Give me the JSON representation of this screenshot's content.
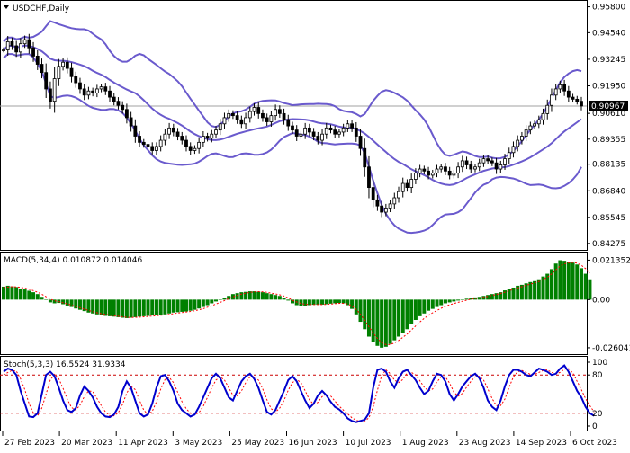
{
  "symbol_label": "USDCHF,Daily",
  "current_price_label": "0.90967",
  "price_axis_labels": [
    "0.95800",
    "0.94540",
    "0.93245",
    "0.91950",
    "0.90610",
    "0.89355",
    "0.88135",
    "0.86840",
    "0.85545",
    "0.84275"
  ],
  "macd": {
    "title": "MACD(5,34,4) 0.010872 0.014046",
    "axis_labels": [
      "0.021352",
      "0.00",
      "-0.026041"
    ]
  },
  "stoch": {
    "title": "Stoch(5,3,3) 16.5524 31.9334",
    "axis_labels": [
      "100",
      "80",
      "20",
      "0"
    ]
  },
  "date_labels": [
    "27 Feb 2023",
    "20 Mar 2023",
    "11 Apr 2023",
    "3 May 2023",
    "25 May 2023",
    "16 Jun 2023",
    "10 Jul 2023",
    "1 Aug 2023",
    "23 Aug 2023",
    "14 Sep 2023",
    "6 Oct 2023"
  ],
  "colors": {
    "candle": "#000000",
    "bollinger": "#6a5acd",
    "macd_hist": "#008000",
    "macd_signal": "#ff0000",
    "stoch_main": "#0000cd",
    "stoch_signal": "#ff0000",
    "level_line": "#cc0000",
    "grid_price": "#a0a0a0"
  },
  "chart_data": [
    {
      "type": "candlestick",
      "title": "USDCHF,Daily",
      "ylim": [
        0.8405,
        0.96
      ],
      "closes": [
        0.937,
        0.941,
        0.939,
        0.936,
        0.94,
        0.942,
        0.938,
        0.934,
        0.93,
        0.926,
        0.918,
        0.912,
        0.923,
        0.929,
        0.931,
        0.928,
        0.924,
        0.921,
        0.918,
        0.915,
        0.917,
        0.916,
        0.918,
        0.919,
        0.917,
        0.914,
        0.912,
        0.91,
        0.908,
        0.904,
        0.9,
        0.895,
        0.892,
        0.891,
        0.89,
        0.888,
        0.89,
        0.893,
        0.896,
        0.899,
        0.897,
        0.895,
        0.893,
        0.89,
        0.888,
        0.889,
        0.892,
        0.895,
        0.894,
        0.896,
        0.898,
        0.901,
        0.904,
        0.906,
        0.905,
        0.903,
        0.901,
        0.904,
        0.907,
        0.909,
        0.906,
        0.904,
        0.902,
        0.905,
        0.908,
        0.906,
        0.903,
        0.9,
        0.898,
        0.895,
        0.896,
        0.899,
        0.897,
        0.895,
        0.893,
        0.896,
        0.899,
        0.898,
        0.896,
        0.897,
        0.899,
        0.901,
        0.899,
        0.895,
        0.889,
        0.88,
        0.87,
        0.864,
        0.861,
        0.858,
        0.86,
        0.862,
        0.865,
        0.868,
        0.872,
        0.87,
        0.874,
        0.877,
        0.879,
        0.878,
        0.876,
        0.877,
        0.879,
        0.88,
        0.878,
        0.876,
        0.877,
        0.88,
        0.883,
        0.881,
        0.879,
        0.88,
        0.882,
        0.884,
        0.883,
        0.882,
        0.879,
        0.881,
        0.884,
        0.887,
        0.89,
        0.893,
        0.895,
        0.898,
        0.9,
        0.901,
        0.903,
        0.906,
        0.91,
        0.915,
        0.918,
        0.92,
        0.917,
        0.914,
        0.913,
        0.912,
        0.9097
      ]
    },
    {
      "type": "bar",
      "title": "MACD(5,34,4) 0.010872 0.014046",
      "ylim": [
        -0.0285,
        0.0235
      ],
      "values": [
        0.007,
        0.0075,
        0.0072,
        0.0068,
        0.006,
        0.0055,
        0.0048,
        0.004,
        0.003,
        0.0015,
        0.0,
        -0.0015,
        -0.002,
        -0.0018,
        -0.0025,
        -0.0032,
        -0.004,
        -0.0048,
        -0.0055,
        -0.0062,
        -0.007,
        -0.0075,
        -0.008,
        -0.0085,
        -0.0088,
        -0.009,
        -0.0092,
        -0.0095,
        -0.0098,
        -0.01,
        -0.0098,
        -0.0095,
        -0.0092,
        -0.009,
        -0.0088,
        -0.0086,
        -0.0085,
        -0.0083,
        -0.008,
        -0.0075,
        -0.007,
        -0.0068,
        -0.0066,
        -0.0064,
        -0.006,
        -0.0055,
        -0.0048,
        -0.004,
        -0.003,
        -0.002,
        -0.001,
        0.0,
        0.001,
        0.002,
        0.003,
        0.0035,
        0.004,
        0.0042,
        0.0045,
        0.0045,
        0.0043,
        0.004,
        0.0035,
        0.003,
        0.0025,
        0.002,
        0.001,
        -0.0005,
        -0.002,
        -0.003,
        -0.0035,
        -0.0033,
        -0.003,
        -0.0028,
        -0.0028,
        -0.0027,
        -0.0025,
        -0.0022,
        -0.002,
        -0.0018,
        -0.002,
        -0.003,
        -0.005,
        -0.008,
        -0.012,
        -0.016,
        -0.02,
        -0.023,
        -0.025,
        -0.026,
        -0.0255,
        -0.024,
        -0.022,
        -0.02,
        -0.018,
        -0.016,
        -0.013,
        -0.011,
        -0.009,
        -0.0075,
        -0.006,
        -0.005,
        -0.004,
        -0.003,
        -0.002,
        -0.0015,
        -0.001,
        -0.0005,
        0.0,
        0.0005,
        0.001,
        0.0012,
        0.0015,
        0.002,
        0.0025,
        0.003,
        0.0035,
        0.004,
        0.005,
        0.006,
        0.0065,
        0.0075,
        0.008,
        0.0088,
        0.0095,
        0.01,
        0.011,
        0.0125,
        0.014,
        0.0165,
        0.0195,
        0.0213,
        0.021,
        0.0205,
        0.02,
        0.019,
        0.017,
        0.014,
        0.011
      ],
      "signal": [
        0.0065,
        0.0068,
        0.007,
        0.0069,
        0.0066,
        0.0062,
        0.0056,
        0.0049,
        0.004,
        0.0029,
        0.0016,
        0.0003,
        -0.0006,
        -0.0011,
        -0.0017,
        -0.0023,
        -0.003,
        -0.0037,
        -0.0044,
        -0.0051,
        -0.0058,
        -0.0065,
        -0.0071,
        -0.0076,
        -0.008,
        -0.0084,
        -0.0087,
        -0.009,
        -0.0093,
        -0.0096,
        -0.0097,
        -0.0096,
        -0.0095,
        -0.0093,
        -0.0091,
        -0.0089,
        -0.0087,
        -0.0085,
        -0.0083,
        -0.008,
        -0.0076,
        -0.0073,
        -0.007,
        -0.0067,
        -0.0064,
        -0.006,
        -0.0055,
        -0.0049,
        -0.0041,
        -0.0033,
        -0.0024,
        -0.0015,
        -0.0005,
        0.0005,
        0.0015,
        0.0023,
        0.003,
        0.0035,
        0.0039,
        0.0042,
        0.0043,
        0.0042,
        0.0039,
        0.0035,
        0.0031,
        0.0026,
        0.0019,
        0.0009,
        -0.0003,
        -0.0013,
        -0.0021,
        -0.0025,
        -0.0027,
        -0.0027,
        -0.0027,
        -0.0027,
        -0.0026,
        -0.0024,
        -0.0022,
        -0.002,
        -0.002,
        -0.0024,
        -0.0034,
        -0.0052,
        -0.0079,
        -0.0111,
        -0.0147,
        -0.018,
        -0.021,
        -0.0232,
        -0.0243,
        -0.0243,
        -0.0234,
        -0.0221,
        -0.0204,
        -0.0186,
        -0.0164,
        -0.0142,
        -0.0121,
        -0.0102,
        -0.0085,
        -0.0071,
        -0.0059,
        -0.0047,
        -0.0036,
        -0.0028,
        -0.0021,
        -0.0015,
        -0.0009,
        -0.0003,
        0.0002,
        0.0006,
        0.0009,
        0.0013,
        0.0018,
        0.0023,
        0.0028,
        0.0033,
        0.004,
        0.0048,
        0.0055,
        0.0063,
        0.007,
        0.0077,
        0.0084,
        0.009,
        0.0098,
        0.0109,
        0.0121,
        0.0139,
        0.0161,
        0.0182,
        0.0193,
        0.02,
        0.0201,
        0.0197,
        0.0186,
        0.0168,
        0.0144
      ]
    },
    {
      "type": "line",
      "title": "Stoch(5,3,3) 16.5524 31.9334",
      "ylim": [
        0,
        100
      ],
      "levels": [
        80,
        20
      ],
      "series": [
        {
          "values": [
            85,
            90,
            88,
            80,
            55,
            35,
            15,
            14,
            20,
            50,
            80,
            85,
            78,
            60,
            40,
            25,
            22,
            28,
            48,
            62,
            55,
            45,
            30,
            20,
            15,
            14,
            18,
            30,
            55,
            70,
            60,
            40,
            20,
            15,
            18,
            35,
            60,
            78,
            80,
            70,
            55,
            35,
            25,
            20,
            15,
            18,
            30,
            45,
            60,
            75,
            82,
            75,
            60,
            45,
            40,
            55,
            70,
            78,
            82,
            74,
            60,
            40,
            22,
            18,
            25,
            40,
            55,
            72,
            78,
            70,
            55,
            40,
            28,
            35,
            48,
            55,
            48,
            38,
            30,
            26,
            20,
            12,
            8,
            6,
            8,
            10,
            20,
            60,
            88,
            90,
            85,
            70,
            60,
            75,
            85,
            88,
            80,
            72,
            60,
            50,
            55,
            70,
            82,
            80,
            70,
            50,
            40,
            50,
            62,
            70,
            78,
            82,
            75,
            60,
            40,
            30,
            25,
            40,
            62,
            80,
            88,
            88,
            85,
            80,
            78,
            84,
            90,
            88,
            85,
            80,
            82,
            90,
            95,
            85,
            70,
            55,
            45,
            30,
            20,
            16
          ]
        },
        {
          "values": [
            80,
            84,
            87,
            86,
            74,
            57,
            35,
            21,
            16,
            28,
            50,
            72,
            81,
            74,
            59,
            42,
            29,
            25,
            33,
            46,
            55,
            54,
            43,
            32,
            22,
            16,
            16,
            21,
            34,
            52,
            62,
            57,
            40,
            25,
            18,
            23,
            38,
            58,
            73,
            76,
            68,
            53,
            38,
            27,
            20,
            18,
            21,
            31,
            45,
            60,
            72,
            77,
            72,
            60,
            48,
            47,
            55,
            68,
            77,
            78,
            72,
            58,
            41,
            27,
            22,
            28,
            40,
            56,
            68,
            73,
            68,
            55,
            41,
            34,
            37,
            46,
            50,
            47,
            39,
            31,
            25,
            19,
            13,
            9,
            7,
            8,
            13,
            30,
            56,
            79,
            88,
            82,
            72,
            68,
            73,
            83,
            84,
            80,
            71,
            61,
            55,
            58,
            69,
            77,
            77,
            67,
            53,
            47,
            51,
            61,
            70,
            77,
            78,
            72,
            58,
            43,
            32,
            32,
            42,
            61,
            77,
            85,
            87,
            84,
            81,
            81,
            84,
            87,
            88,
            84,
            82,
            84,
            89,
            90,
            83,
            70,
            57,
            43,
            32,
            22
          ]
        }
      ]
    }
  ]
}
